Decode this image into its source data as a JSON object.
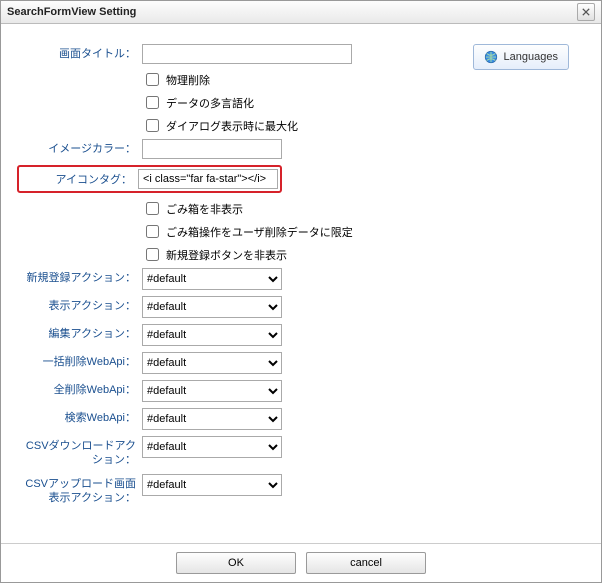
{
  "window": {
    "title": "SearchFormView Setting"
  },
  "toolbar": {
    "languages_label": "Languages"
  },
  "labels": {
    "screen_title": "画面タイトル：",
    "physical_delete": "物理削除",
    "data_i18n": "データの多言語化",
    "dialog_maximize": "ダイアログ表示時に最大化",
    "image_color": "イメージカラー：",
    "icon_tag": "アイコンタグ：",
    "hide_trash": "ごみ箱を非表示",
    "trash_user_only": "ごみ箱操作をユーザ削除データに限定",
    "hide_new_button": "新規登録ボタンを非表示",
    "new_action": "新規登録アクション：",
    "view_action": "表示アクション：",
    "edit_action": "編集アクション：",
    "bulk_delete_webapi": "一括削除WebApi：",
    "delete_all_webapi": "全削除WebApi：",
    "search_webapi": "検索WebApi：",
    "csv_download_action": "CSVダウンロードアクション：",
    "csv_upload_action": "CSVアップロード画面表示アクション："
  },
  "values": {
    "screen_title": "",
    "image_color": "",
    "icon_tag": "<i class=\"far fa-star\"></i>",
    "default_option": "#default"
  },
  "checks": {
    "physical_delete": false,
    "data_i18n": false,
    "dialog_maximize": false,
    "hide_trash": false,
    "trash_user_only": false,
    "hide_new_button": false
  },
  "buttons": {
    "ok": "OK",
    "cancel": "cancel"
  }
}
